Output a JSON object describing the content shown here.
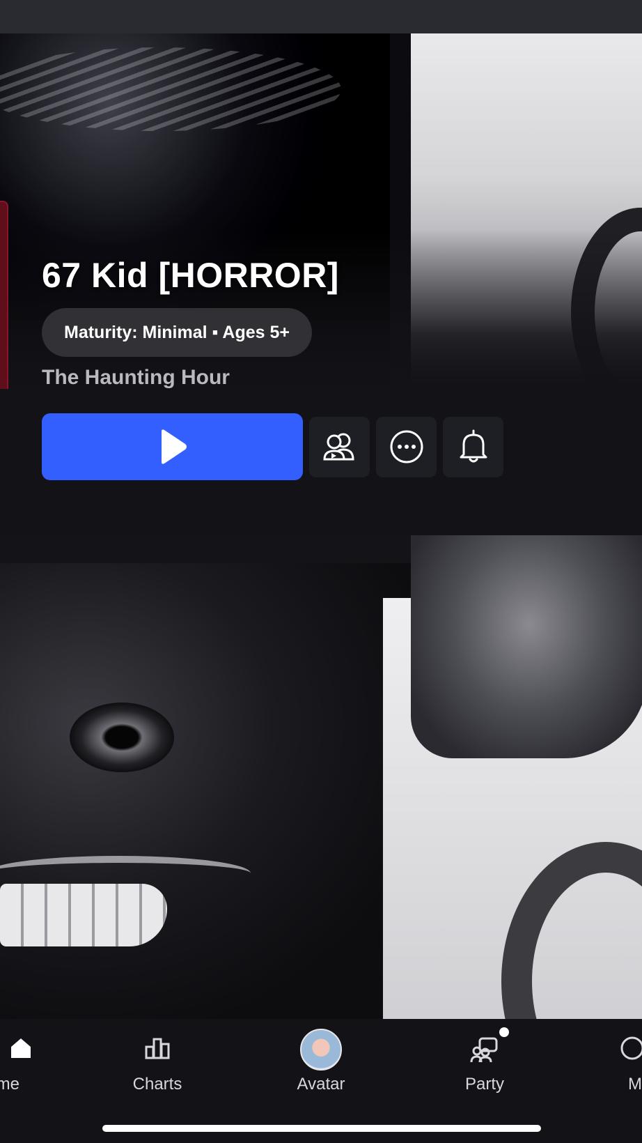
{
  "game": {
    "title": "67 Kid [HORROR]",
    "maturity": "Maturity: Minimal ▪ Ages 5+",
    "creator": "The Haunting Hour"
  },
  "actions": {
    "play_icon": "play-icon",
    "party_icon": "party-play-icon",
    "more_icon": "more-icon",
    "notify_icon": "bell-icon"
  },
  "nav": {
    "home": "me",
    "charts": "Charts",
    "avatar": "Avatar",
    "party": "Party",
    "more": "M"
  },
  "colors": {
    "play_button": "#335fff",
    "background": "#121217"
  }
}
